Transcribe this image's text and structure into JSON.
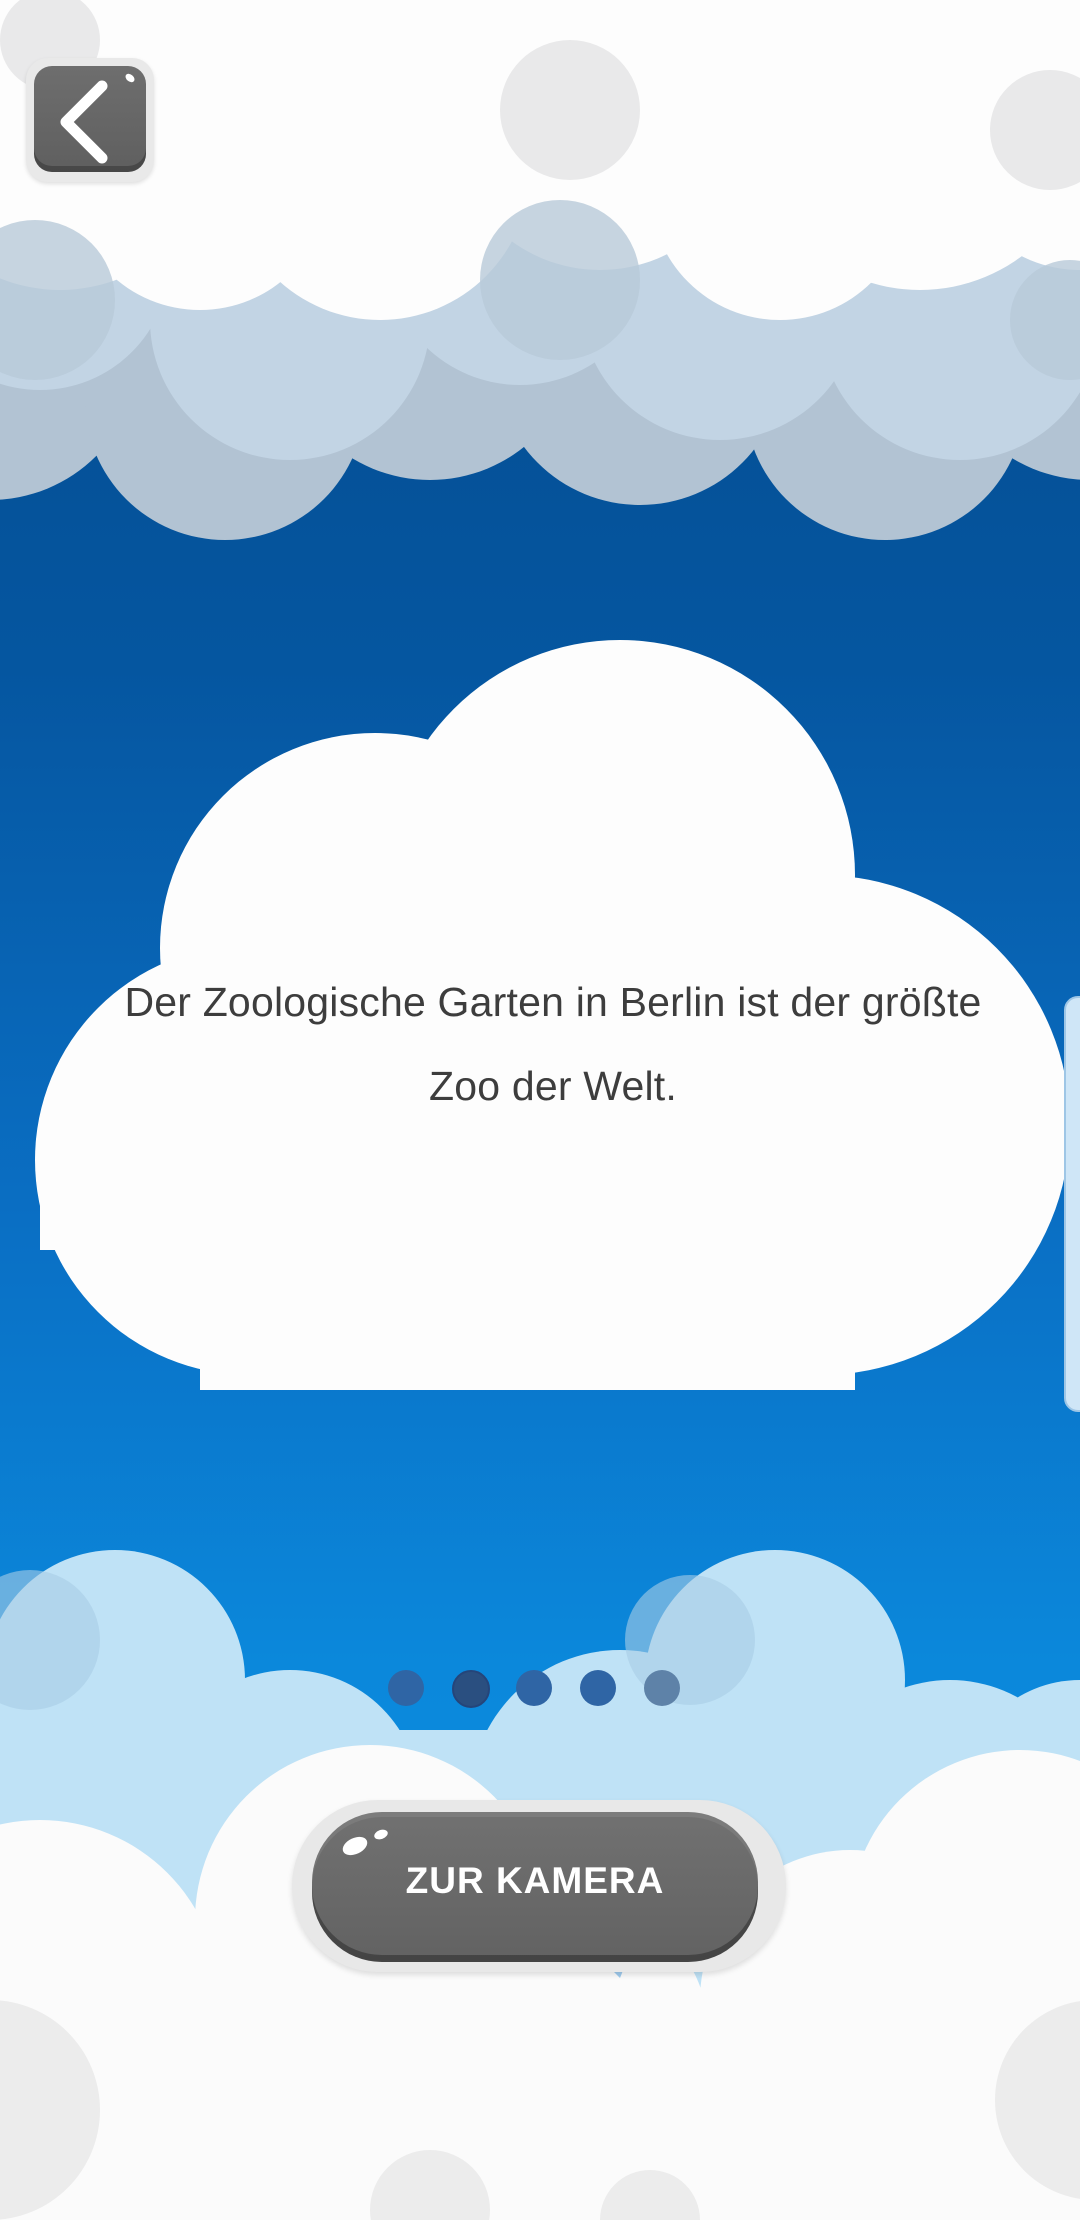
{
  "header": {
    "back_icon": "chevron-left-icon"
  },
  "fact_card": {
    "text": "Der Zoologische Garten in Berlin ist der größte Zoo der Welt."
  },
  "pagination": {
    "count": 5,
    "active_index": 1
  },
  "camera_button": {
    "label": "ZUR KAMERA"
  },
  "colors": {
    "sky_top": "#04498a",
    "sky_bottom": "#0c92e3",
    "cloud_white": "#fdfdfd",
    "cloud_blue_light": "#c2d4e4",
    "cloud_blue_dark": "#b2c3d3",
    "cloud_pale": "#bfe2f6",
    "button_gray": "#666666",
    "text_dark": "#3d3d3d",
    "dot_active": "#2a4f80",
    "dot_inactive": "#2f65a5",
    "dot_last": "#5e82a8"
  }
}
